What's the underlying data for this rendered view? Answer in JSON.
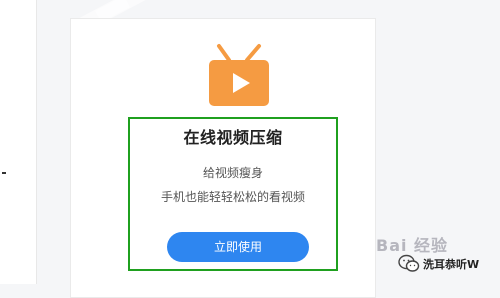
{
  "card": {
    "icon": "tv-play-icon",
    "title": "在线视频压缩",
    "subtitle": "给视频瘦身",
    "description": "手机也能轻轻松松的看视频",
    "cta_label": "立即使用"
  },
  "watermark": {
    "baidu_text": "Bai 经验",
    "wechat_icon": "wechat-icon",
    "account": "洗耳恭听W"
  },
  "colors": {
    "icon_orange": "#f59b42",
    "highlight_green": "#1fa01f",
    "cta_blue": "#2e86f0"
  }
}
